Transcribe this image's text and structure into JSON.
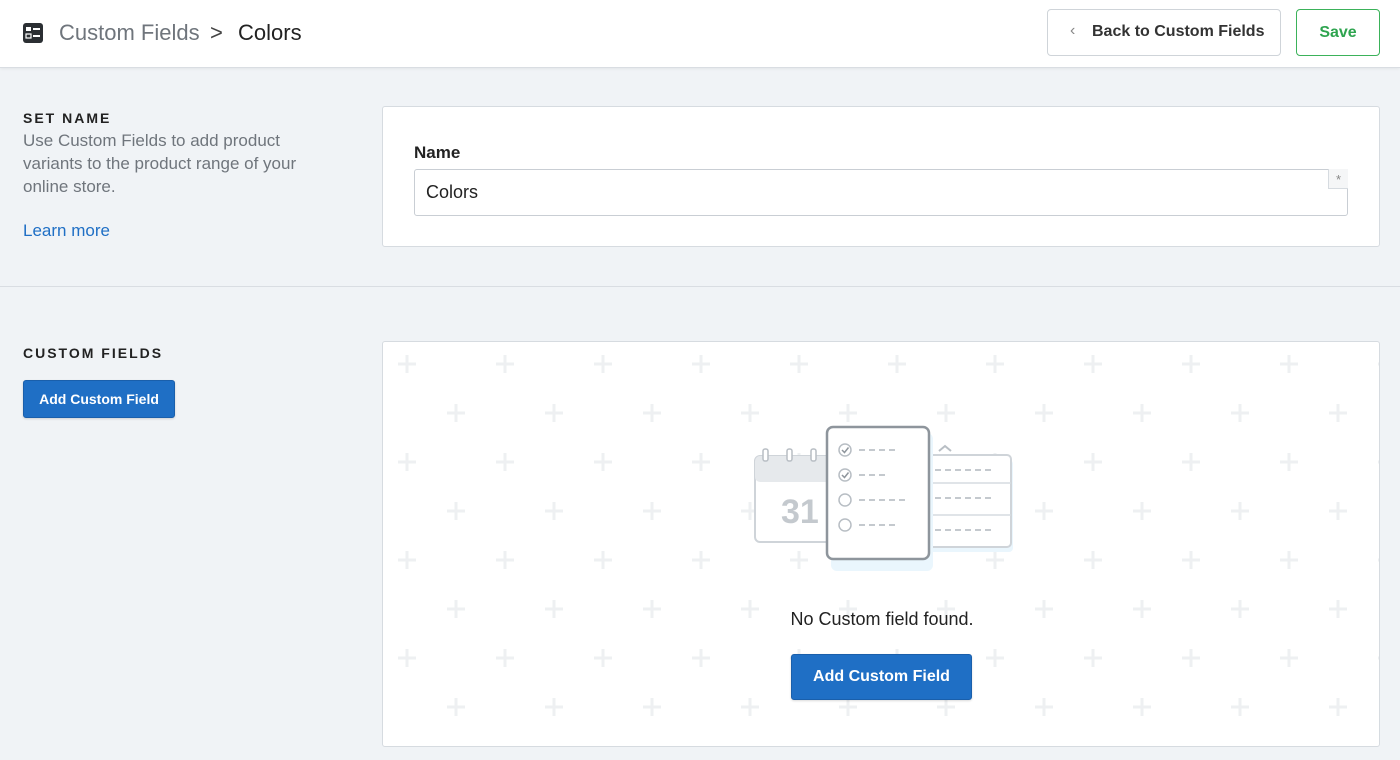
{
  "header": {
    "app_icon": "list-panel-icon",
    "breadcrumb_parent": "Custom Fields",
    "breadcrumb_separator": ">",
    "breadcrumb_current": "Colors",
    "back_chevron": "‹",
    "back_button_label": "Back to Custom Fields",
    "save_button_label": "Save"
  },
  "set_name": {
    "title": "SET NAME",
    "description": "Use Custom Fields to add product variants to the product range of your online store.",
    "learn_more": "Learn more",
    "field_label": "Name",
    "field_value": "Colors",
    "required_mark": "*"
  },
  "custom_fields": {
    "title": "CUSTOM FIELDS",
    "add_button_label": "Add Custom Field",
    "empty_state_text": "No Custom field found.",
    "empty_state_button_label": "Add Custom Field",
    "illustration_calendar_number": "31"
  },
  "colors": {
    "primary": "#1f6fc5",
    "save_green": "#2ea44f",
    "link": "#1f6fc5",
    "background": "#f0f3f6"
  }
}
